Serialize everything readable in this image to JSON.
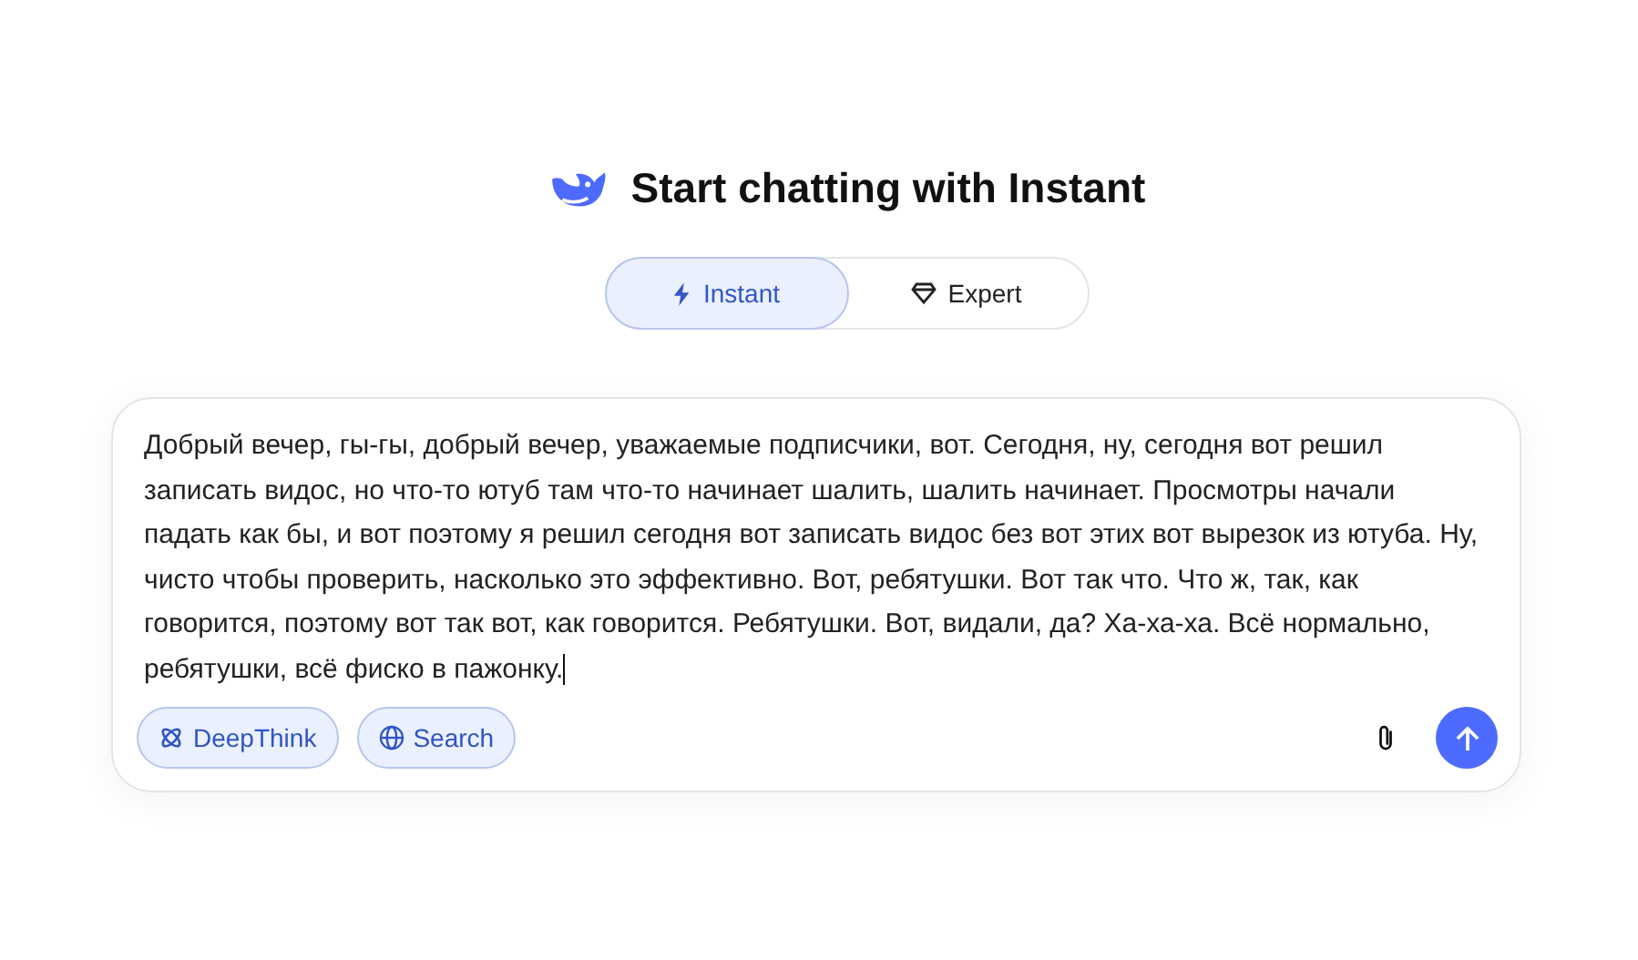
{
  "header": {
    "title": "Start chatting with Instant"
  },
  "modes": [
    {
      "label": "Instant",
      "kind": "bolt",
      "selected": true
    },
    {
      "label": "Expert",
      "kind": "gem",
      "selected": false
    }
  ],
  "composer": {
    "value": "Добрый вечер, гы-гы, добрый вечер, уважаемые подписчики, вот. Сегодня, ну, сегодня вот решил записать видос, но что-то ютуб там что-то начинает шалить, шалить начинает. Просмотры начали падать как бы, и вот поэтому я решил сегодня вот записать видос без вот этих вот вырезок из ютуба. Ну, чисто чтобы проверить, насколько это эффективно. Вот, ребятушки. Вот так что. Что ж, так, как говорится, поэтому вот так вот, как говорится. Ребятушки. Вот, видали, да? Ха-ха-ха. Всё нормально, ребятушки, всё фиско в пажонку.",
    "toggles": [
      {
        "label": "DeepThink",
        "kind": "atom",
        "selected": true
      },
      {
        "label": "Search",
        "kind": "globe",
        "selected": true
      }
    ]
  }
}
